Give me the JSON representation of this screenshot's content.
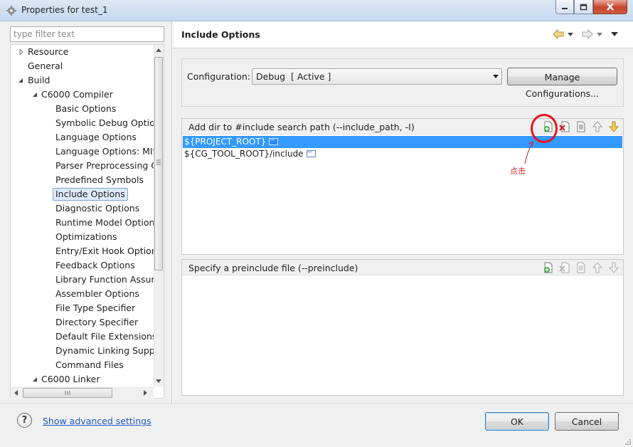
{
  "window": {
    "title": "Properties for test_1",
    "icons": [
      "gear-app-icon",
      "minimize-icon",
      "maximize-icon",
      "close-icon"
    ]
  },
  "filter": {
    "placeholder": "type filter text"
  },
  "tree": {
    "items": [
      {
        "label": "Resource",
        "state": "collapsed"
      },
      {
        "label": "General"
      },
      {
        "label": "Build",
        "state": "expanded"
      },
      {
        "label": "C6000 Compiler",
        "state": "expanded"
      },
      {
        "label": "Basic Options"
      },
      {
        "label": "Symbolic Debug Option"
      },
      {
        "label": "Language Options"
      },
      {
        "label": "Language Options: MIS"
      },
      {
        "label": "Parser Preprocessing O"
      },
      {
        "label": "Predefined Symbols"
      },
      {
        "label": "Include Options",
        "selected": true
      },
      {
        "label": "Diagnostic Options"
      },
      {
        "label": "Runtime Model Options"
      },
      {
        "label": "Optimizations"
      },
      {
        "label": "Entry/Exit Hook Options"
      },
      {
        "label": "Feedback Options"
      },
      {
        "label": "Library Function Assum"
      },
      {
        "label": "Assembler Options"
      },
      {
        "label": "File Type Specifier"
      },
      {
        "label": "Directory Specifier"
      },
      {
        "label": "Default File Extensions"
      },
      {
        "label": "Dynamic Linking Suppo"
      },
      {
        "label": "Command Files"
      },
      {
        "label": "C6000 Linker",
        "state": "expanded"
      }
    ]
  },
  "page": {
    "title": "Include Options"
  },
  "configuration": {
    "label": "Configuration:",
    "selected": "Debug  [ Active ]",
    "manage_label": "Manage Configurations..."
  },
  "include_path": {
    "title": "Add dir to #include search path (--include_path, -I)",
    "entries": [
      "${PROJECT_ROOT}",
      "${CG_TOOL_ROOT}/include"
    ],
    "tools": [
      "add-icon",
      "delete-icon",
      "edit-icon",
      "move-up-icon",
      "move-down-icon"
    ]
  },
  "preinclude": {
    "title": "Specify a preinclude file (--preinclude)",
    "entries": []
  },
  "annotation": {
    "note": "点击",
    "color": "#e8141c"
  },
  "footer": {
    "help_symbol": "?",
    "advanced_link": "Show advanced settings",
    "ok_label": "OK",
    "cancel_label": "Cancel"
  },
  "colors": {
    "selection": "#3399ff",
    "tree_selection": "#dcebfc",
    "link": "#1f5bc7"
  }
}
